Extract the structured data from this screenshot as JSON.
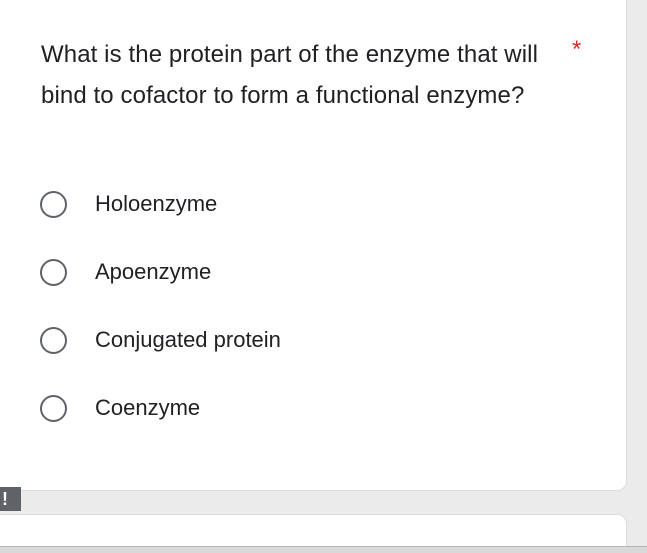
{
  "question": {
    "text": "What is the protein part of the enzyme that will bind to cofactor to form a functional enzyme?",
    "required_marker": "*"
  },
  "options": [
    {
      "label": "Holoenzyme",
      "selected": false
    },
    {
      "label": "Apoenzyme",
      "selected": false
    },
    {
      "label": "Conjugated protein",
      "selected": false
    },
    {
      "label": "Coenzyme",
      "selected": false
    }
  ],
  "side_flag": {
    "icon": "exclamation-icon",
    "glyph": "!"
  },
  "colors": {
    "required": "#d93025",
    "text": "#202124",
    "radio_border": "#5f6368",
    "background": "#ebebeb",
    "card": "#ffffff"
  }
}
